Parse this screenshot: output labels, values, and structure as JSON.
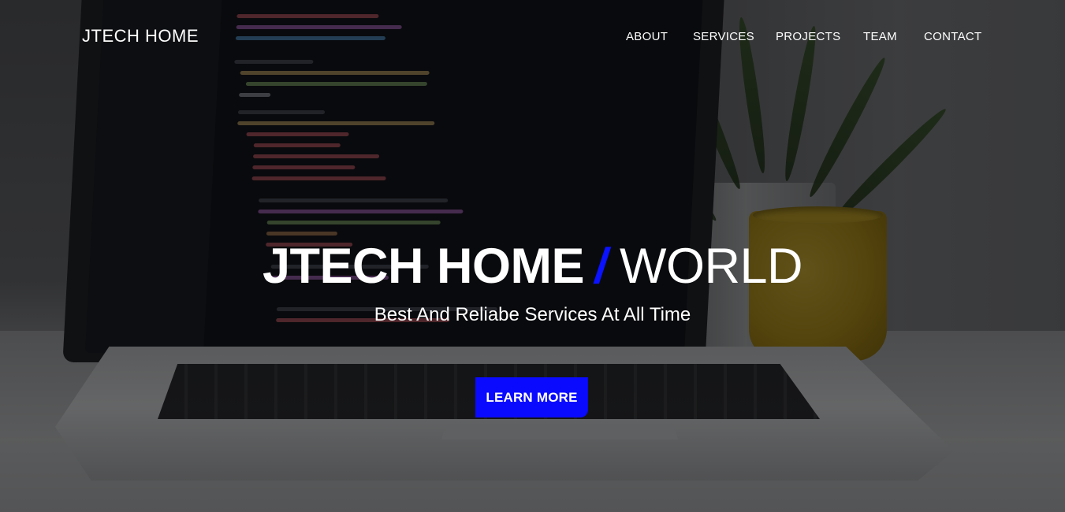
{
  "navbar": {
    "brand": "JTECH HOME",
    "links": [
      {
        "label": "ABOUT"
      },
      {
        "label": "SERVICES"
      },
      {
        "label": "PROJECTS"
      },
      {
        "label": "TEAM"
      },
      {
        "label": "CONTACT"
      }
    ]
  },
  "hero": {
    "title_strong": "JTECH HOME",
    "title_slash": "/",
    "title_light": "WORLD",
    "subtitle": "Best And Reliabe Services At All Time",
    "cta_label": "LEARN MORE"
  },
  "colors": {
    "accent": "#0a0aff",
    "text": "#ffffff",
    "overlay": "rgba(0,0,0,0.55)"
  },
  "background": {
    "description_icon": "laptop-code-photo"
  }
}
